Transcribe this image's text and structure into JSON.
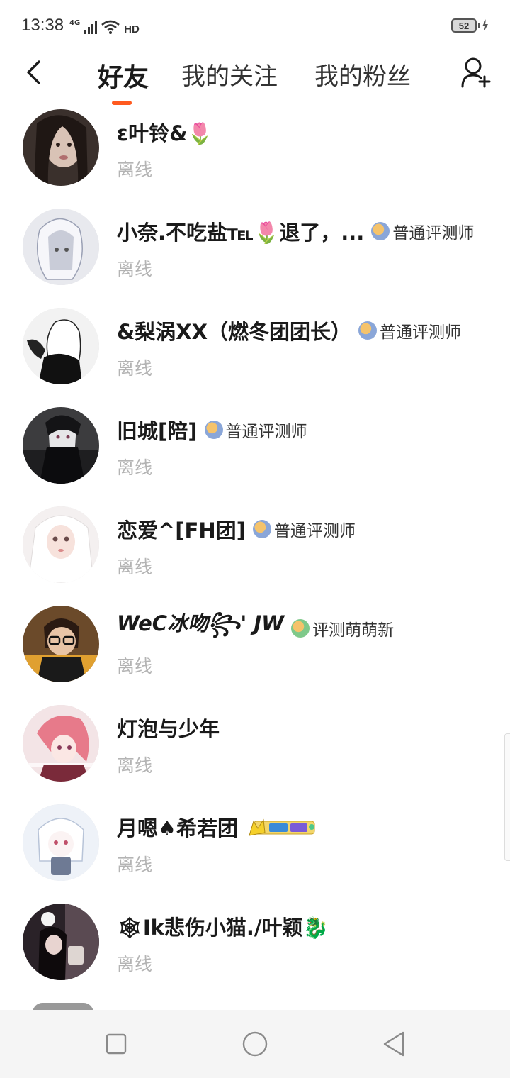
{
  "status_bar": {
    "time": "13:38",
    "network": "4G",
    "hd": "HD",
    "battery": "52"
  },
  "header": {
    "back_icon": "chevron-left-icon",
    "tabs": [
      {
        "label": "好友",
        "active": true
      },
      {
        "label": "我的关注",
        "active": false
      },
      {
        "label": "我的粉丝",
        "active": false
      }
    ],
    "add_friend_icon": "add-user-icon",
    "accent_color": "#ff5a1f"
  },
  "friends": [
    {
      "name": "ε叶铃&🌷",
      "badge": "",
      "status": "离线"
    },
    {
      "name": "小奈.不吃盐℡🌷退了，...",
      "badge": "普通评测师",
      "status": "离线"
    },
    {
      "name": "&梨涡XX（燃冬团团长）",
      "badge": "普通评测师",
      "status": "离线"
    },
    {
      "name": "旧城[陪]",
      "badge": "普通评测师",
      "status": "离线"
    },
    {
      "name": "恋爱^[FH团]",
      "badge": "普通评测师",
      "status": "离线"
    },
    {
      "name": "WeC冰吻꧂' JW",
      "badge": "评测萌萌新",
      "status": "离线"
    },
    {
      "name": "灯泡与少年",
      "badge": "",
      "status": "离线"
    },
    {
      "name": "月嗯♠希若团",
      "badge": "",
      "status": "离线"
    },
    {
      "name": "🕸Ik悲伤小猫./叶颖🐉",
      "badge": "",
      "status": "离线"
    }
  ],
  "nav_bar": {
    "recent_icon": "square-icon",
    "home_icon": "circle-icon",
    "back_icon": "triangle-back-icon"
  }
}
